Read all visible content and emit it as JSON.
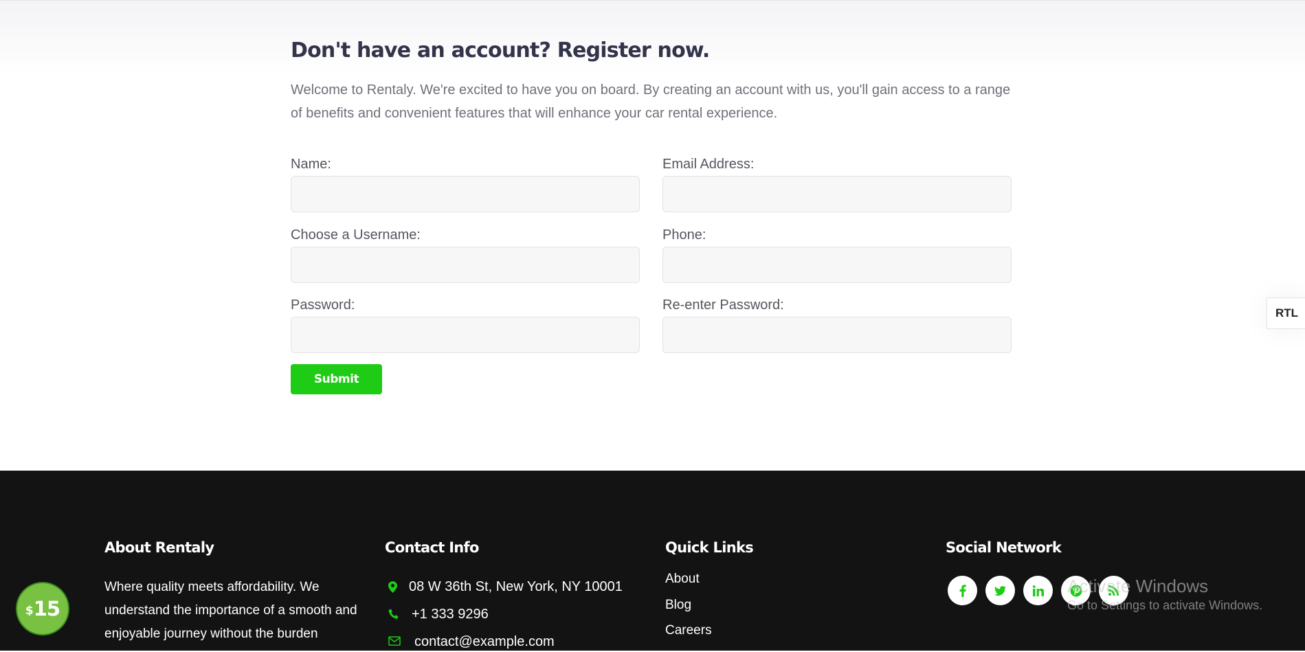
{
  "register": {
    "title": "Don't have an account? Register now.",
    "intro": "Welcome to Rentaly. We're excited to have you on board. By creating an account with us, you'll gain access to a range of benefits and convenient features that will enhance your car rental experience."
  },
  "form": {
    "name_label": "Name:",
    "email_label": "Email Address:",
    "username_label": "Choose a Username:",
    "phone_label": "Phone:",
    "password_label": "Password:",
    "repassword_label": "Re-enter Password:",
    "submit_label": "Submit"
  },
  "rtl_label": "RTL",
  "footer": {
    "about_title": "About Rentaly",
    "about_text": "Where quality meets affordability. We understand the importance of a smooth and enjoyable journey without the burden",
    "contact_title": "Contact Info",
    "address": "08 W 36th St, New York, NY 10001",
    "phone": "+1 333 9296",
    "email": "contact@example.com",
    "quick_links_title": "Quick Links",
    "quick_links": [
      "About",
      "Blog",
      "Careers"
    ],
    "social_title": "Social Network",
    "social_icons": [
      "facebook-icon",
      "twitter-icon",
      "linkedin-icon",
      "pinterest-icon",
      "rss-icon"
    ]
  },
  "price_badge": {
    "currency": "$",
    "amount": "15"
  },
  "watermark": {
    "title": "Activate Windows",
    "subtitle": "Go to Settings to activate Windows."
  },
  "colors": {
    "accent": "#1ecb15",
    "footer_bg": "#131313",
    "badge": "#79c142"
  }
}
